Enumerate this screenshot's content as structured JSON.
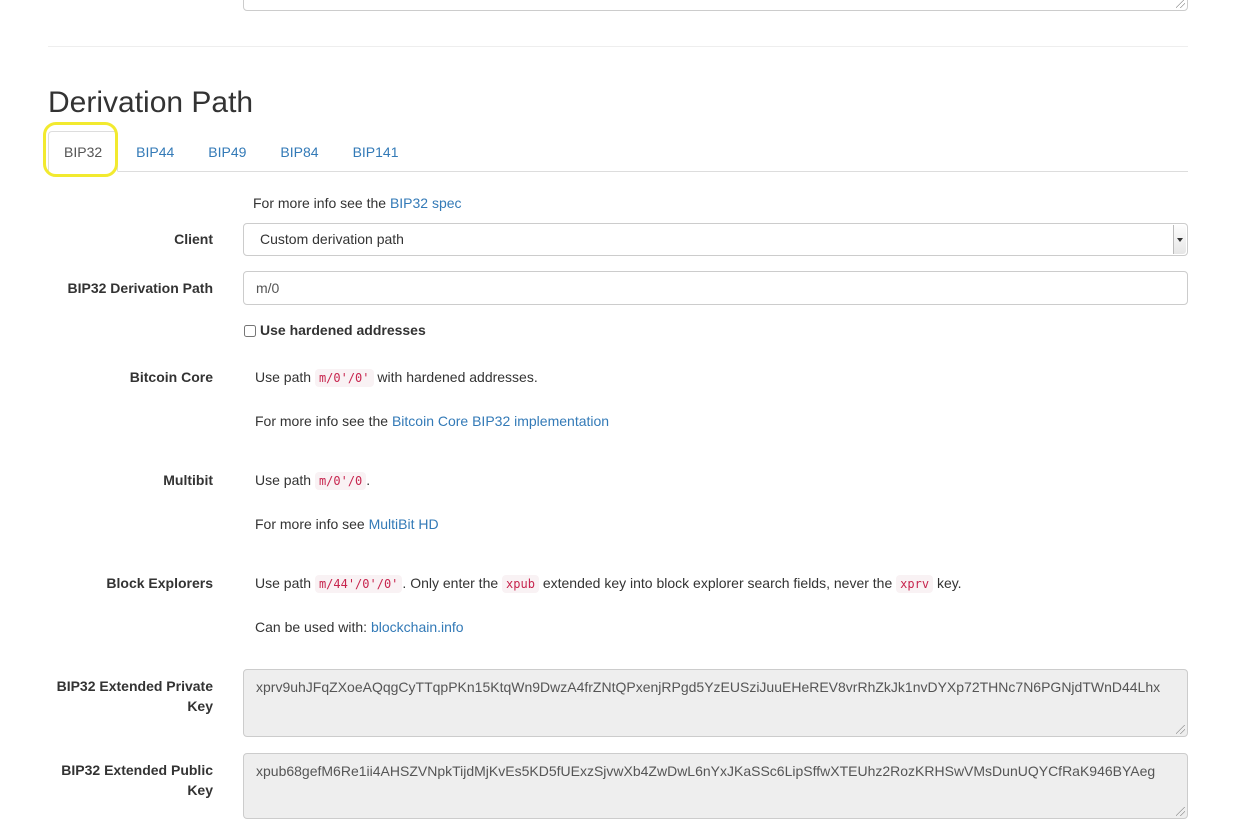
{
  "section": {
    "title": "Derivation Path"
  },
  "tabs": [
    {
      "label": "BIP32",
      "active": true
    },
    {
      "label": "BIP44"
    },
    {
      "label": "BIP49"
    },
    {
      "label": "BIP84"
    },
    {
      "label": "BIP141"
    }
  ],
  "spec_info": {
    "prefix": "For more info see the",
    "link": "BIP32 spec"
  },
  "client": {
    "label": "Client",
    "selected": "Custom derivation path"
  },
  "derivation_path": {
    "label": "BIP32 Derivation Path",
    "value": "m/0"
  },
  "hardened": {
    "label": "Use hardened addresses",
    "checked": false
  },
  "bitcoin_core": {
    "label": "Bitcoin Core",
    "use_prefix": "Use path",
    "path": "m/0'/0'",
    "use_suffix": "with hardened addresses.",
    "info_prefix": "For more info see the",
    "info_link": "Bitcoin Core BIP32 implementation"
  },
  "multibit": {
    "label": "Multibit",
    "use_prefix": "Use path",
    "path": "m/0'/0",
    "use_suffix": ".",
    "info_prefix": "For more info see",
    "info_link": "MultiBit HD"
  },
  "block_explorers": {
    "label": "Block Explorers",
    "use_prefix": "Use path",
    "path": "m/44'/0'/0'",
    "text1": ". Only enter the",
    "xpub": "xpub",
    "text2": "extended key into block explorer search fields, never the",
    "xprv": "xprv",
    "text3": "key.",
    "used_with_prefix": "Can be used with:",
    "used_with_link": "blockchain.info"
  },
  "ext_private": {
    "label_line1": "BIP32 Extended Private",
    "label_line2": "Key",
    "value": "xprv9uhJFqZXoeAQqgCyTTqpPKn15KtqWn9DwzA4frZNtQPxenjRPgd5YzEUSziJuuEHeREV8vrRhZkJk1nvDYXp72THNc7N6PGNjdTWnD44Lhx"
  },
  "ext_public": {
    "label_line1": "BIP32 Extended Public",
    "label_line2": "Key",
    "value": "xpub68gefM6Re1ii4AHSZVNpkTijdMjKvEs5KD5fUExzSjvwXb4ZwDwL6nYxJKaSSc6LipSffwXTEUhz2RozKRHSwVMsDunUQYCfRaK946BYAeg"
  },
  "colors": {
    "link": "#337ab7",
    "highlight": "#f2ea2f",
    "code": "#c7254e"
  }
}
